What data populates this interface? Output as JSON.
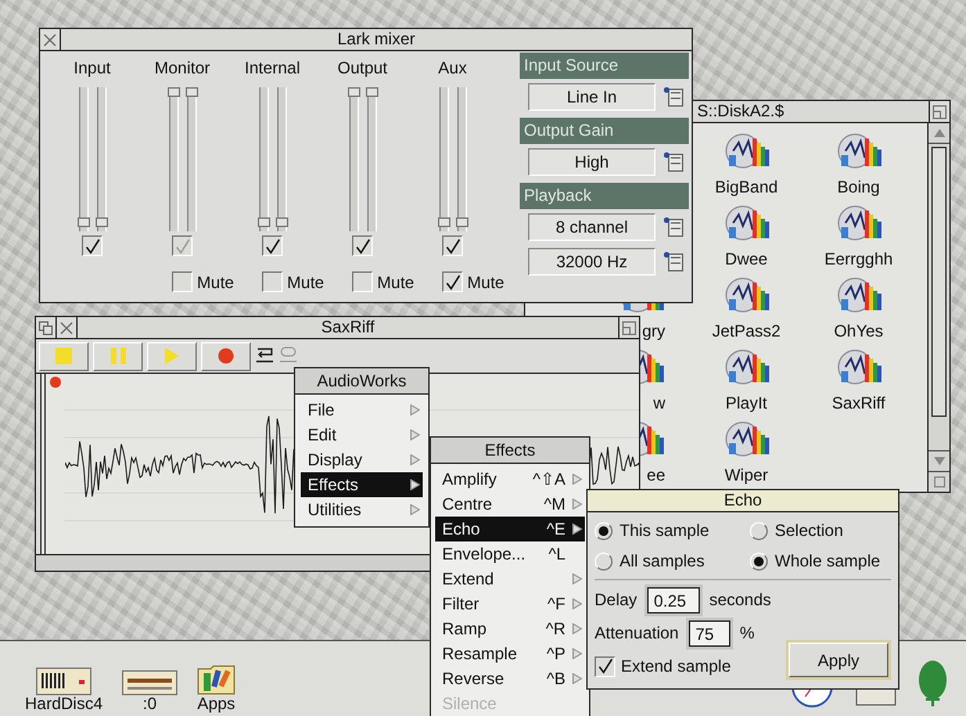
{
  "mixer": {
    "title": "Lark mixer",
    "channels": [
      {
        "name": "Input",
        "sliders": [
          {
            "level": 0.03
          },
          {
            "level": 0.03
          }
        ],
        "enable": {
          "checked": true,
          "disabled": false
        }
      },
      {
        "name": "Monitor",
        "sliders": [
          {
            "level": 1
          },
          {
            "level": 1
          }
        ],
        "enable": {
          "checked": true,
          "disabled": true
        },
        "mute": {
          "label": "Mute",
          "checked": false
        }
      },
      {
        "name": "Internal",
        "sliders": [
          {
            "level": 0.03
          },
          {
            "level": 0.03
          }
        ],
        "enable": {
          "checked": true,
          "disabled": false
        },
        "mute": {
          "label": "Mute",
          "checked": false
        }
      },
      {
        "name": "Output",
        "sliders": [
          {
            "level": 1
          },
          {
            "level": 1
          }
        ],
        "enable": {
          "checked": true,
          "disabled": false
        },
        "mute": {
          "label": "Mute",
          "checked": false
        }
      },
      {
        "name": "Aux",
        "sliders": [
          {
            "level": 0.03
          },
          {
            "level": 0.03
          }
        ],
        "enable": {
          "checked": true,
          "disabled": false
        },
        "mute": {
          "label": "Mute",
          "checked": true
        }
      }
    ],
    "settings": [
      {
        "heading": "Input Source",
        "fields": [
          "Line In"
        ]
      },
      {
        "heading": "Output Gain",
        "fields": [
          "High"
        ]
      },
      {
        "heading": "Playback",
        "fields": [
          "8 channel",
          "32000 Hz"
        ]
      }
    ]
  },
  "filer": {
    "title": "S::DiskA2.$",
    "rows": [
      [
        {
          "name": "BigBand",
          "kind": "file"
        },
        {
          "name": "Boing",
          "kind": "file"
        }
      ],
      [
        {
          "name": "Dwee",
          "kind": "file"
        },
        {
          "name": "Eerrgghh",
          "kind": "file"
        }
      ],
      [
        {
          "name": "gry",
          "kind": "partial"
        },
        {
          "name": "JetPass2",
          "kind": "file"
        },
        {
          "name": "OhYes",
          "kind": "file"
        }
      ],
      [
        {
          "name": "w",
          "kind": "partial"
        },
        {
          "name": "PlayIt",
          "kind": "file"
        },
        {
          "name": "SaxRiff",
          "kind": "file"
        }
      ],
      [
        {
          "name": "ee",
          "kind": "partial"
        },
        {
          "name": "Wiper",
          "kind": "file"
        }
      ]
    ]
  },
  "sample_window": {
    "title": "SaxRiff"
  },
  "menu": {
    "title": "AudioWorks",
    "items": [
      {
        "label": "File",
        "selected": false,
        "submenu": true
      },
      {
        "label": "Edit",
        "selected": false,
        "submenu": true
      },
      {
        "label": "Display",
        "selected": false,
        "submenu": true
      },
      {
        "label": "Effects",
        "selected": true,
        "submenu": true
      },
      {
        "label": "Utilities",
        "selected": false,
        "submenu": true
      }
    ]
  },
  "effects_menu": {
    "title": "Effects",
    "items": [
      {
        "label": "Amplify",
        "shortcut": "^⇧A",
        "submenu": true,
        "selected": false,
        "disabled": false
      },
      {
        "label": "Centre",
        "shortcut": "^M",
        "submenu": true,
        "selected": false,
        "disabled": false
      },
      {
        "label": "Echo",
        "shortcut": "^E",
        "submenu": true,
        "selected": true,
        "disabled": false
      },
      {
        "label": "Envelope...",
        "shortcut": "^L",
        "submenu": false,
        "selected": false,
        "disabled": false
      },
      {
        "label": "Extend",
        "submenu": true,
        "selected": false,
        "disabled": false
      },
      {
        "label": "Filter",
        "shortcut": "^F",
        "submenu": true,
        "selected": false,
        "disabled": false
      },
      {
        "label": "Ramp",
        "shortcut": "^R",
        "submenu": true,
        "selected": false,
        "disabled": false
      },
      {
        "label": "Resample",
        "shortcut": "^P",
        "submenu": true,
        "selected": false,
        "disabled": false
      },
      {
        "label": "Reverse",
        "shortcut": "^B",
        "submenu": true,
        "selected": false,
        "disabled": false
      },
      {
        "label": "Silence",
        "submenu": false,
        "selected": false,
        "disabled": true
      }
    ]
  },
  "echo_dialog": {
    "title": "Echo",
    "scope": [
      {
        "label": "This sample",
        "selected": true
      },
      {
        "label": "All samples",
        "selected": false
      }
    ],
    "range": [
      {
        "label": "Selection",
        "selected": false
      },
      {
        "label": "Whole sample",
        "selected": true
      }
    ],
    "delay": {
      "label": "Delay",
      "value": "0.25",
      "unit": "seconds"
    },
    "attenuation": {
      "label": "Attenuation",
      "value": "75",
      "unit": "%"
    },
    "extend": {
      "label": "Extend sample",
      "checked": true
    },
    "apply": "Apply"
  },
  "iconbar": {
    "items": [
      {
        "label": "HardDisc4",
        "kind": "harddisc"
      },
      {
        "label": ":0",
        "kind": "floppy"
      },
      {
        "label": "Apps",
        "kind": "apps"
      }
    ]
  }
}
